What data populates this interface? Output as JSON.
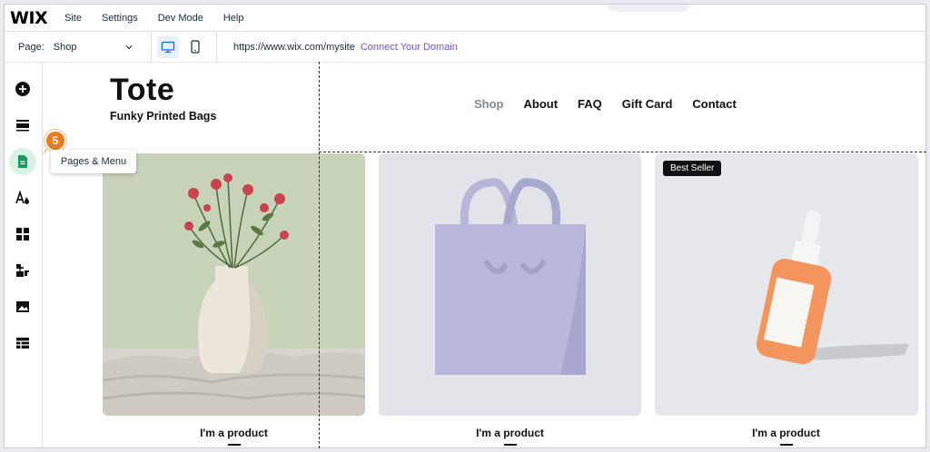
{
  "topbar": {
    "logo": "WIX",
    "menu": [
      "Site",
      "Settings",
      "Dev Mode",
      "Help"
    ]
  },
  "pagebar": {
    "page_label": "Page:",
    "page_value": "Shop",
    "url": "https://www.wix.com/mysite",
    "connect_domain": "Connect Your Domain"
  },
  "rail": {
    "icons": [
      "add-icon",
      "sections-icon",
      "pages-icon",
      "design-icon",
      "apps-grid-icon",
      "puzzle-icon",
      "media-icon",
      "table-icon"
    ],
    "badge": "5",
    "tooltip": "Pages & Menu"
  },
  "site": {
    "title": "Tote",
    "subtitle": "Funky Printed Bags",
    "nav": [
      "Shop",
      "About",
      "FAQ",
      "Gift Card",
      "Contact"
    ],
    "best_seller": "Best Seller",
    "products": [
      "I'm a product",
      "I'm a product",
      "I'm a product"
    ]
  },
  "colors": {
    "accent_purple": "#7a4fd4",
    "badge_orange": "#e97b1d",
    "active_green": "#d9f2e6"
  }
}
